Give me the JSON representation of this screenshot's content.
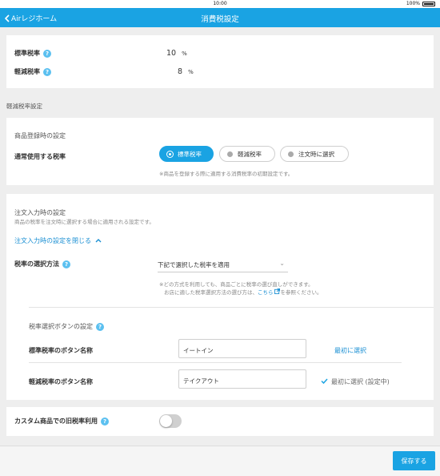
{
  "status_bar": {
    "time": "10:00",
    "battery": "100%"
  },
  "nav": {
    "back_label": "Airレジホーム",
    "title": "消費税設定"
  },
  "tax_rates": {
    "standard_label": "標準税率",
    "standard_value": "10",
    "reduced_label": "軽減税率",
    "reduced_value": "8",
    "unit": "%"
  },
  "reduced_section_title": "軽減税率設定",
  "product_registration": {
    "title": "商品登録時の設定",
    "default_rate_label": "通常使用する税率",
    "options": [
      "標準税率",
      "軽減税率",
      "注文時に選択"
    ],
    "selected_index": 0,
    "note": "※商品を登録する際に適用する消費税率の初期設定です。"
  },
  "order_entry": {
    "title": "注文入力時の設定",
    "description": "商品の税率を注文時に選択する場合に適用される設定です。",
    "toggle_link": "注文入力時の設定を閉じる",
    "method_label": "税率の選択方法",
    "method_value": "下記で選択した税率を適用",
    "note_line1": "※どの方式を利用しても、商品ごとに税率の選び直しができます。",
    "note_line2_prefix": "お店に適した税率選択方法の選び方は、",
    "note_link": "こちら",
    "note_line2_suffix": "を参照ください。"
  },
  "button_settings": {
    "title": "税率選択ボタンの設定",
    "standard_name_label": "標準税率のボタン名称",
    "standard_name_value": "イートイン",
    "standard_action": "最初に選択",
    "reduced_name_label": "軽減税率のボタン名称",
    "reduced_name_value": "テイクアウト",
    "reduced_status": "最初に選択 (設定中)"
  },
  "custom_product": {
    "label": "カスタム商品での旧税率利用",
    "enabled": false
  },
  "footer": {
    "save_label": "保存する"
  },
  "colors": {
    "accent": "#1aa3e3",
    "link": "#1a8fd3"
  }
}
